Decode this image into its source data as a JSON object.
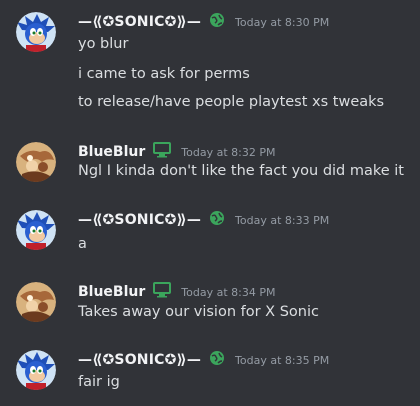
{
  "colors": {
    "background": "#313338",
    "username": "#f2f3f5",
    "text": "#dbdee1",
    "timestamp": "#949ba4",
    "globe_badge": "#3ba55c",
    "monitor_badge": "#3ba55c"
  },
  "messages": [
    {
      "author": "—⟪✪SONIC✪⟫—",
      "badge": "globe-icon",
      "timestamp": "Today at 8:30 PM",
      "lines": [
        "yo blur",
        "i came to ask for perms",
        "to release/have people playtest xs tweaks"
      ]
    },
    {
      "author": "BlueBlur",
      "badge": "monitor-icon",
      "timestamp": "Today at 8:32 PM",
      "lines": [
        "Ngl I kinda don't like the fact you did make it"
      ]
    },
    {
      "author": "—⟪✪SONIC✪⟫—",
      "badge": "globe-icon",
      "timestamp": "Today at 8:33 PM",
      "lines": [
        "a"
      ]
    },
    {
      "author": "BlueBlur",
      "badge": "monitor-icon",
      "timestamp": "Today at 8:34 PM",
      "lines": [
        "Takes away our vision for X Sonic"
      ]
    },
    {
      "author": "—⟪✪SONIC✪⟫—",
      "badge": "globe-icon",
      "timestamp": "Today at 8:35 PM",
      "lines": [
        "fair ig"
      ]
    }
  ]
}
